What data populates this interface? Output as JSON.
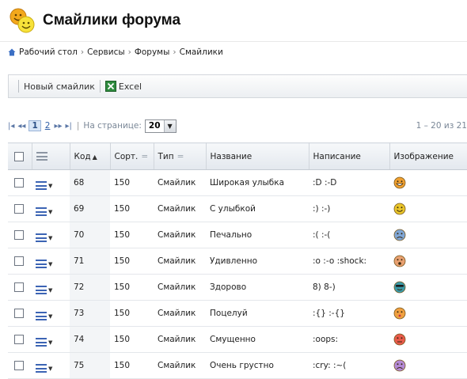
{
  "page": {
    "title": "Смайлики форума"
  },
  "breadcrumb": {
    "items": [
      "Рабочий стол",
      "Сервисы",
      "Форумы",
      "Смайлики"
    ]
  },
  "toolbar": {
    "new_label": "Новый смайлик",
    "excel_label": "Excel"
  },
  "pager": {
    "first": "⏮",
    "prev": "◂◂",
    "pages": [
      "1",
      "2"
    ],
    "current_page": "1",
    "next": "▸▸",
    "last": "⏭",
    "per_page_label": "На странице:",
    "per_page_value": "20",
    "count_text": "1 – 20 из 21"
  },
  "grid": {
    "headers": {
      "code": "Код",
      "sort": "Сорт.",
      "type": "Тип",
      "name": "Название",
      "writing": "Написание",
      "image": "Изображение"
    },
    "rows": [
      {
        "code": "68",
        "sort": "150",
        "type": "Смайлик",
        "name": "Широкая улыбка",
        "writing": ":D :-D",
        "face": "grin",
        "color": "#f0a030"
      },
      {
        "code": "69",
        "sort": "150",
        "type": "Смайлик",
        "name": "С улыбкой",
        "writing": ":) :-)",
        "face": "smile",
        "color": "#e9c52a"
      },
      {
        "code": "70",
        "sort": "150",
        "type": "Смайлик",
        "name": "Печально",
        "writing": ":( :-(",
        "face": "sad",
        "color": "#7fa6d6"
      },
      {
        "code": "71",
        "sort": "150",
        "type": "Смайлик",
        "name": "Удивленно",
        "writing": ":o :-o :shock:",
        "face": "shock",
        "color": "#e8a070"
      },
      {
        "code": "72",
        "sort": "150",
        "type": "Смайлик",
        "name": "Здорово",
        "writing": "8) 8-)",
        "face": "cool",
        "color": "#3a9aa8"
      },
      {
        "code": "73",
        "sort": "150",
        "type": "Смайлик",
        "name": "Поцелуй",
        "writing": ":{} :-{}",
        "face": "kiss",
        "color": "#f0a040"
      },
      {
        "code": "74",
        "sort": "150",
        "type": "Смайлик",
        "name": "Смущенно",
        "writing": ":oops:",
        "face": "oops",
        "color": "#e85a4a"
      },
      {
        "code": "75",
        "sort": "150",
        "type": "Смайлик",
        "name": "Очень грустно",
        "writing": ":cry: :~(",
        "face": "cry",
        "color": "#b48ad6"
      }
    ]
  },
  "icons": {
    "home": "home-icon",
    "excel": "excel-icon",
    "row_menu": "row-menu-icon",
    "logo": "smileys-logo-icon"
  }
}
